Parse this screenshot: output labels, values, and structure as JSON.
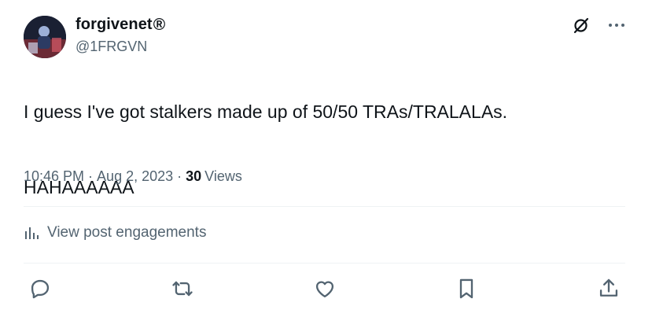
{
  "author": {
    "display_name": "forgivenet",
    "badge": "®",
    "handle": "@1FRGVN"
  },
  "tweet": {
    "lines": [
      "I guess I've got stalkers made up of 50/50 TRAs/TRALALAs.",
      "HAHAAAAAA"
    ]
  },
  "meta": {
    "time": "10:46 PM",
    "separator": "·",
    "date": "Aug 2, 2023",
    "views_count": "30",
    "views_label": "Views"
  },
  "engagements": {
    "label": "View post engagements"
  },
  "actions": [
    "reply",
    "repost",
    "like",
    "bookmark",
    "share"
  ],
  "colors": {
    "text_primary": "#0f1419",
    "text_secondary": "#536471",
    "divider": "#eff3f4"
  }
}
